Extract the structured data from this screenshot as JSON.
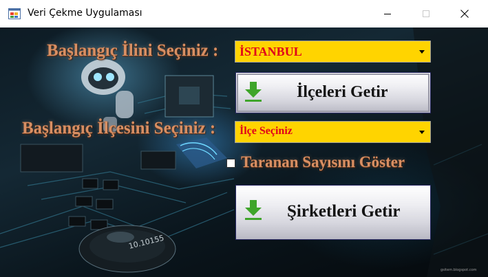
{
  "window": {
    "title": "Veri Çekme Uygulaması"
  },
  "form": {
    "city_label": "Başlangıç İlini Seçiniz :",
    "city_select_value": "İSTANBUL",
    "get_districts_button": "İlçeleri Getir",
    "district_label": "Başlangıç İlçesini Seçiniz :",
    "district_select_value": "İlçe Seçiniz",
    "show_count_checkbox_label": "Taranan Sayısını Göster",
    "show_count_checked": false,
    "get_companies_button": "Şirketleri Getir"
  },
  "background": {
    "chip_label": "10.10155",
    "watermark": "gsitem.blogspot.com"
  },
  "colors": {
    "combo_background": "#ffd400",
    "combo_text": "#e0001b",
    "label_text": "#d88f63",
    "download_icon": "#3fa52a"
  }
}
